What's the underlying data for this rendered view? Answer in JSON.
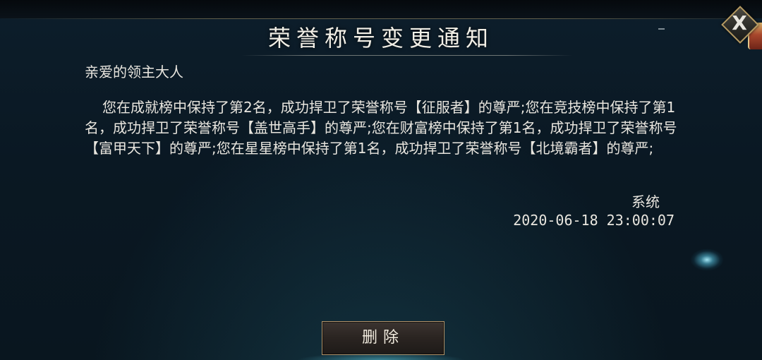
{
  "dialog": {
    "title": "荣誉称号变更通知",
    "greeting": "亲爱的领主大人",
    "body": "您在成就榜中保持了第2名，成功捍卫了荣誉称号【征服者】的尊严;您在竞技榜中保持了第1名，成功捍卫了荣誉称号【盖世高手】的尊严;您在财富榜中保持了第1名，成功捍卫了荣誉称号【富甲天下】的尊严;您在星星榜中保持了第1名，成功捍卫了荣誉称号【北境霸者】的尊严;",
    "sender": "系统",
    "timestamp": "2020-06-18 23:00:07",
    "delete_label": "删除",
    "close_label": "X"
  },
  "icons": {
    "close": "close-icon",
    "sparkle": "sparkle-icon"
  },
  "colors": {
    "background": "#0b1a26",
    "text": "#e9e6df",
    "accent_gold": "#b59a62"
  }
}
